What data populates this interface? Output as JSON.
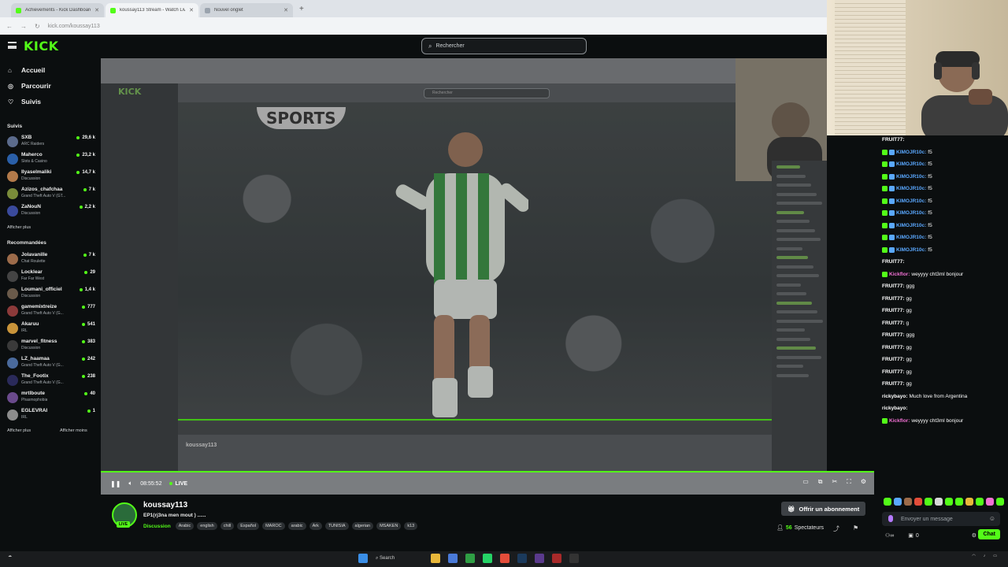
{
  "browser": {
    "tabs": [
      {
        "label": "Achievements - Kick Dashboard",
        "active": false
      },
      {
        "label": "koussay113 Stream - Watch Liv",
        "active": true
      },
      {
        "label": "Nouvel onglet",
        "active": false
      }
    ],
    "new_tab": "+",
    "url": "kick.com/koussay113"
  },
  "header": {
    "logo": "KICK",
    "search_placeholder": "Rechercher"
  },
  "sidebar": {
    "nav": [
      {
        "label": "Accueil",
        "icon": "home-icon",
        "glyph": "⌂"
      },
      {
        "label": "Parcourir",
        "icon": "compass-icon",
        "glyph": "◎"
      },
      {
        "label": "Suivis",
        "icon": "heart-icon",
        "glyph": "♡"
      }
    ],
    "followed_title": "Suivis",
    "followed": [
      {
        "name": "SXB",
        "category": "ARC Raiders",
        "viewers": "29,6 k",
        "color": "#5b6b8c"
      },
      {
        "name": "Maherco",
        "category": "Slots & Casino",
        "viewers": "23,2 k",
        "color": "#2a5fa8"
      },
      {
        "name": "Ilyaselmaliki",
        "category": "Discussion",
        "viewers": "14,7 k",
        "color": "#b37a4a"
      },
      {
        "name": "Azizos_chafchaa",
        "category": "Grand Theft Auto V (GT...",
        "viewers": "7 k",
        "color": "#7a8c3a"
      },
      {
        "name": "ZaNouN",
        "category": "Discussion",
        "viewers": "2,2 k",
        "color": "#3a4a9c"
      }
    ],
    "show_more": "Afficher plus",
    "recommended_title": "Recommandées",
    "recommended": [
      {
        "name": "Jolavanille",
        "category": "Chat Roulette",
        "viewers": "7 k",
        "color": "#9c6b4a"
      },
      {
        "name": "Locklear",
        "category": "Far Far West",
        "viewers": "29",
        "color": "#444444"
      },
      {
        "name": "Loumani_officiel",
        "category": "Discussion",
        "viewers": "1,4 k",
        "color": "#6a5a4a"
      },
      {
        "name": "gamemixtreize",
        "category": "Grand Theft Auto V (G...",
        "viewers": "777",
        "color": "#8c3a3a"
      },
      {
        "name": "Akaruu",
        "category": "IRL",
        "viewers": "541",
        "color": "#c9943a"
      },
      {
        "name": "marvel_fitness",
        "category": "Discussion",
        "viewers": "383",
        "color": "#3a3a3a"
      },
      {
        "name": "LZ_haamaa",
        "category": "Grand Theft Auto V (G...",
        "viewers": "242",
        "color": "#4a6a9c"
      },
      {
        "name": "The_Footix",
        "category": "Grand Theft Auto V (G...",
        "viewers": "238",
        "color": "#2a2a5a"
      },
      {
        "name": "mrtlboute",
        "category": "Phasmophobia",
        "viewers": "40",
        "color": "#6a4a8c"
      },
      {
        "name": "EGLEVRAI",
        "category": "IRL",
        "viewers": "1",
        "color": "#8c8c8c"
      }
    ],
    "show_more2": "Afficher plus",
    "show_less": "Afficher moins"
  },
  "player": {
    "brand_text": "SPORTS",
    "time": "08:55:52",
    "live_label": "LIVE"
  },
  "stream": {
    "streamer": "koussay113",
    "title": "EP1(rj3na men mout ) ......",
    "category": "Discussion",
    "tags": [
      "Arabic",
      "english",
      "chill",
      "Español",
      "MAROC",
      "arabic",
      "Ark",
      "TUNISIA",
      "algerian",
      "MSAKEN",
      "k13"
    ],
    "live_badge": "LIVE",
    "subscribe": "Offrir un abonnement",
    "viewers_count": "56",
    "viewers_label": "Spectateurs"
  },
  "chat": {
    "messages": [
      {
        "user": "FRUIT77:",
        "text": "",
        "cls": "u-white",
        "badges": 0
      },
      {
        "user": "KIMOJR10c:",
        "text": "f5",
        "cls": "u-blue",
        "badges": 2
      },
      {
        "user": "KIMOJR10c:",
        "text": "f5",
        "cls": "u-blue",
        "badges": 2
      },
      {
        "user": "KIMOJR10c:",
        "text": "f5",
        "cls": "u-blue",
        "badges": 2
      },
      {
        "user": "KIMOJR10c:",
        "text": "f5",
        "cls": "u-blue",
        "badges": 2
      },
      {
        "user": "KIMOJR10c:",
        "text": "f5",
        "cls": "u-blue",
        "badges": 2
      },
      {
        "user": "KIMOJR10c:",
        "text": "f5",
        "cls": "u-blue",
        "badges": 2
      },
      {
        "user": "KIMOJR10c:",
        "text": "f5",
        "cls": "u-blue",
        "badges": 2
      },
      {
        "user": "KIMOJR10c:",
        "text": "f5",
        "cls": "u-blue",
        "badges": 2
      },
      {
        "user": "KIMOJR10c:",
        "text": "f5",
        "cls": "u-blue",
        "badges": 2
      },
      {
        "user": "FRUIT77:",
        "text": "",
        "cls": "u-white",
        "badges": 0
      },
      {
        "user": "Kickflor:",
        "text": "weyyyy cht3ml bonjour",
        "cls": "u-pink",
        "badges": 1
      },
      {
        "user": "FRUIT77:",
        "text": "ggg",
        "cls": "u-white",
        "badges": 0
      },
      {
        "user": "FRUIT77:",
        "text": "gg",
        "cls": "u-white",
        "badges": 0
      },
      {
        "user": "FRUIT77:",
        "text": "gg",
        "cls": "u-white",
        "badges": 0
      },
      {
        "user": "FRUIT77:",
        "text": "g",
        "cls": "u-white",
        "badges": 0
      },
      {
        "user": "FRUIT77:",
        "text": "ggg",
        "cls": "u-white",
        "badges": 0
      },
      {
        "user": "FRUIT77:",
        "text": "gg",
        "cls": "u-white",
        "badges": 0
      },
      {
        "user": "FRUIT77:",
        "text": "gg",
        "cls": "u-white",
        "badges": 0
      },
      {
        "user": "FRUIT77:",
        "text": "gg",
        "cls": "u-white",
        "badges": 0
      },
      {
        "user": "FRUIT77:",
        "text": "gg",
        "cls": "u-white",
        "badges": 0
      },
      {
        "user": "rickybayo:",
        "text": "Much love from Argentina",
        "cls": "u-white",
        "badges": 0
      },
      {
        "user": "rickybayo:",
        "text": "",
        "cls": "u-white",
        "badges": 0
      },
      {
        "user": "Kickflor:",
        "text": "weyyyy cht3ml bonjour",
        "cls": "u-pink",
        "badges": 1
      }
    ],
    "input_placeholder": "Envoyer un message",
    "points": "0",
    "chat_button": "Chat"
  },
  "taskbar": {
    "search_label": "Search"
  },
  "colors": {
    "brand": "#53fc18"
  }
}
